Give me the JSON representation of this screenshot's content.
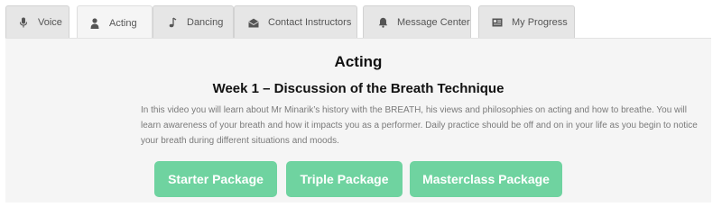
{
  "tabs": [
    {
      "label": "Voice",
      "icon": "microphone-icon"
    },
    {
      "label": "Acting",
      "icon": "person-icon"
    },
    {
      "label": "Dancing",
      "icon": "music-note-icon"
    },
    {
      "label": "Contact Instructors",
      "icon": "envelope-icon"
    },
    {
      "label": "Message Center",
      "icon": "bell-icon"
    },
    {
      "label": "My Progress",
      "icon": "progress-card-icon"
    }
  ],
  "active_tab": "Acting",
  "main": {
    "title": "Acting",
    "video_title": "Week 1 – Discussion of the Breath Technique",
    "description": "In this video you will learn about Mr Minarik’s history with the BREATH, his views and philosophies on acting and how to breathe. You will learn awareness of your breath and how it impacts you as a performer. Daily practice should be off and on in your  life as you begin to notice your breath during different situations and moods.",
    "buttons": [
      {
        "label": "Starter Package"
      },
      {
        "label": "Triple Package"
      },
      {
        "label": "Masterclass Package"
      }
    ]
  },
  "colors": {
    "button_bg": "#6fd3a0",
    "panel_bg": "#f5f5f5",
    "tab_bg": "#e6e6e6"
  }
}
